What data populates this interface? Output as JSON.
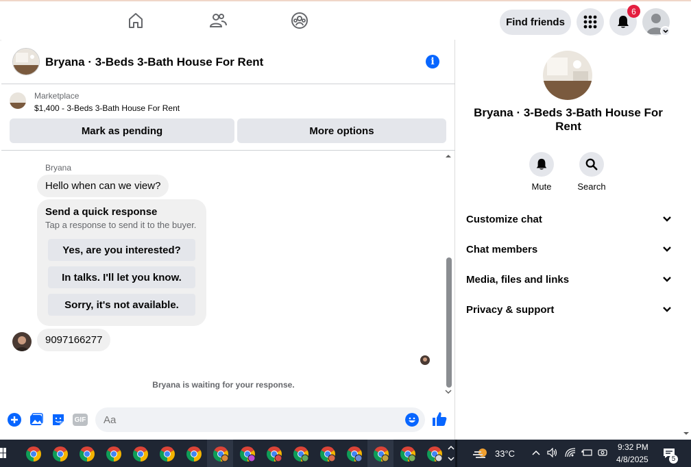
{
  "topbar": {
    "find_friends": "Find friends",
    "notification_count": "6"
  },
  "chat": {
    "title": "Bryana · 3-Beds 3-Bath House For Rent",
    "marketplace_label": "Marketplace",
    "listing": "$1,400 - 3-Beds 3-Bath House For Rent",
    "mark_pending": "Mark as pending",
    "more_options": "More options",
    "sender_name": "Bryana",
    "first_message": "Hello when can we view?",
    "quick_response": {
      "title": "Send a quick response",
      "subtitle": "Tap a response to send it to the buyer.",
      "options": [
        "Yes, are you interested?",
        "In talks. I'll let you know.",
        "Sorry, it's not available."
      ]
    },
    "second_message": "9097166277",
    "waiting": "Bryana is waiting for your response.",
    "input_placeholder": "Aa",
    "gif_label": "GIF"
  },
  "info": {
    "title": "Bryana · 3-Beds 3-Bath House For Rent",
    "mute": "Mute",
    "search": "Search",
    "sections": [
      "Customize chat",
      "Chat members",
      "Media, files and links",
      "Privacy & support"
    ]
  },
  "taskbar": {
    "temperature": "33°C",
    "time": "9:32 PM",
    "date": "4/8/2025",
    "notif_count": "5"
  },
  "colors": {
    "accent": "#0866ff",
    "badge": "#e41e3f",
    "taskbar": "#1f2633"
  }
}
